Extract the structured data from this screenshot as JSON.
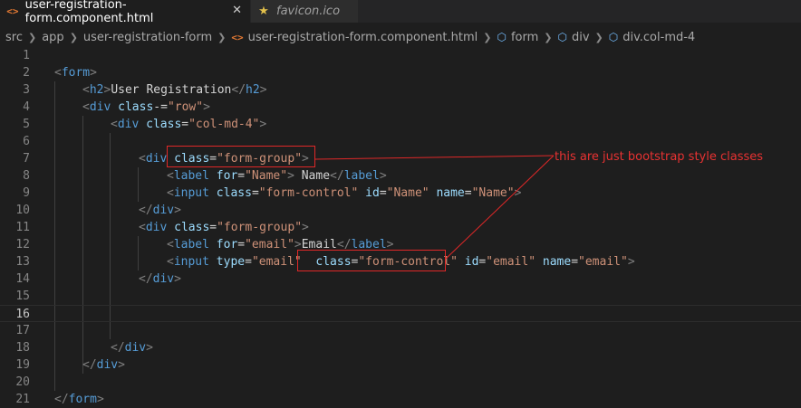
{
  "tabs": [
    {
      "label": "user-registration-form.component.html",
      "icon": "html-icon",
      "active": true,
      "close": "✕"
    },
    {
      "label": "favicon.ico",
      "icon": "star-icon",
      "active": false
    }
  ],
  "breadcrumb": {
    "items": [
      "src",
      "app",
      "user-registration-form",
      "user-registration-form.component.html",
      "form",
      "div",
      "div.col-md-4"
    ]
  },
  "editor": {
    "current_line": 16,
    "lines": [
      {
        "n": "1",
        "tokens": []
      },
      {
        "n": "2",
        "tokens": [
          [
            "br",
            "<"
          ],
          [
            "tag",
            "form"
          ],
          [
            "br",
            ">"
          ]
        ]
      },
      {
        "n": "3",
        "tokens": [
          [
            "br",
            "<"
          ],
          [
            "tag",
            "h2"
          ],
          [
            "br",
            ">"
          ],
          [
            "txt",
            "User Registration"
          ],
          [
            "br",
            "</"
          ],
          [
            "tag",
            "h2"
          ],
          [
            "br",
            ">"
          ]
        ]
      },
      {
        "n": "4",
        "tokens": [
          [
            "br",
            "<"
          ],
          [
            "tag",
            "div"
          ],
          [
            "txt",
            " "
          ],
          [
            "attr",
            "class"
          ],
          [
            "txt",
            "-="
          ],
          [
            "str",
            "\"row\""
          ],
          [
            "br",
            ">"
          ]
        ]
      },
      {
        "n": "5",
        "tokens": [
          [
            "br",
            "<"
          ],
          [
            "tag",
            "div"
          ],
          [
            "txt",
            " "
          ],
          [
            "attr",
            "class"
          ],
          [
            "txt",
            "="
          ],
          [
            "str",
            "\"col-md-4\""
          ],
          [
            "br",
            ">"
          ]
        ]
      },
      {
        "n": "6",
        "tokens": []
      },
      {
        "n": "7",
        "tokens": [
          [
            "br",
            "<"
          ],
          [
            "tag",
            "div"
          ],
          [
            "txt",
            " "
          ],
          [
            "attr",
            "class"
          ],
          [
            "txt",
            "="
          ],
          [
            "str",
            "\"form-group\""
          ],
          [
            "br",
            ">"
          ]
        ]
      },
      {
        "n": "8",
        "tokens": [
          [
            "br",
            "<"
          ],
          [
            "tag",
            "label"
          ],
          [
            "txt",
            " "
          ],
          [
            "attr",
            "for"
          ],
          [
            "txt",
            "="
          ],
          [
            "str",
            "\"Name\""
          ],
          [
            "br",
            ">"
          ],
          [
            "txt",
            " Name"
          ],
          [
            "br",
            "</"
          ],
          [
            "tag",
            "label"
          ],
          [
            "br",
            ">"
          ]
        ]
      },
      {
        "n": "9",
        "tokens": [
          [
            "br",
            "<"
          ],
          [
            "tag",
            "input"
          ],
          [
            "txt",
            " "
          ],
          [
            "attr",
            "class"
          ],
          [
            "txt",
            "="
          ],
          [
            "str",
            "\"form-control\""
          ],
          [
            "txt",
            " "
          ],
          [
            "attr",
            "id"
          ],
          [
            "txt",
            "="
          ],
          [
            "str",
            "\"Name\""
          ],
          [
            "txt",
            " "
          ],
          [
            "attr",
            "name"
          ],
          [
            "txt",
            "="
          ],
          [
            "str",
            "\"Name\""
          ],
          [
            "br",
            ">"
          ]
        ]
      },
      {
        "n": "10",
        "tokens": [
          [
            "br",
            "</"
          ],
          [
            "tag",
            "div"
          ],
          [
            "br",
            ">"
          ]
        ]
      },
      {
        "n": "11",
        "tokens": [
          [
            "br",
            "<"
          ],
          [
            "tag",
            "div"
          ],
          [
            "txt",
            " "
          ],
          [
            "attr",
            "class"
          ],
          [
            "txt",
            "="
          ],
          [
            "str",
            "\"form-group\""
          ],
          [
            "br",
            ">"
          ]
        ]
      },
      {
        "n": "12",
        "tokens": [
          [
            "br",
            "<"
          ],
          [
            "tag",
            "label"
          ],
          [
            "txt",
            " "
          ],
          [
            "attr",
            "for"
          ],
          [
            "txt",
            "="
          ],
          [
            "str",
            "\"email\""
          ],
          [
            "br",
            ">"
          ],
          [
            "txt",
            "Email"
          ],
          [
            "br",
            "</"
          ],
          [
            "tag",
            "label"
          ],
          [
            "br",
            ">"
          ]
        ]
      },
      {
        "n": "13",
        "tokens": [
          [
            "br",
            "<"
          ],
          [
            "tag",
            "input"
          ],
          [
            "txt",
            " "
          ],
          [
            "attr",
            "type"
          ],
          [
            "txt",
            "="
          ],
          [
            "str",
            "\"email\""
          ],
          [
            "txt",
            "  "
          ],
          [
            "attr",
            "class"
          ],
          [
            "txt",
            "="
          ],
          [
            "str",
            "\"form-control\""
          ],
          [
            "txt",
            " "
          ],
          [
            "attr",
            "id"
          ],
          [
            "txt",
            "="
          ],
          [
            "str",
            "\"email\""
          ],
          [
            "txt",
            " "
          ],
          [
            "attr",
            "name"
          ],
          [
            "txt",
            "="
          ],
          [
            "str",
            "\"email\""
          ],
          [
            "br",
            ">"
          ]
        ]
      },
      {
        "n": "14",
        "tokens": [
          [
            "br",
            "</"
          ],
          [
            "tag",
            "div"
          ],
          [
            "br",
            ">"
          ]
        ]
      },
      {
        "n": "15",
        "tokens": []
      },
      {
        "n": "16",
        "tokens": []
      },
      {
        "n": "17",
        "tokens": []
      },
      {
        "n": "18",
        "tokens": [
          [
            "br",
            "</"
          ],
          [
            "tag",
            "div"
          ],
          [
            "br",
            ">"
          ]
        ]
      },
      {
        "n": "19",
        "tokens": [
          [
            "br",
            "</"
          ],
          [
            "tag",
            "div"
          ],
          [
            "br",
            ">"
          ]
        ]
      },
      {
        "n": "20",
        "tokens": []
      },
      {
        "n": "21",
        "tokens": [
          [
            "br",
            "</"
          ],
          [
            "tag",
            "form"
          ],
          [
            "br",
            ">"
          ]
        ]
      }
    ]
  },
  "annotation": {
    "text": "this are just bootstrap style classes",
    "color": "#e02828"
  },
  "colors": {
    "tag": "#569cd6",
    "attr": "#9cdcfe",
    "string": "#ce9178",
    "bracket": "#808080",
    "background": "#1e1e1e"
  }
}
